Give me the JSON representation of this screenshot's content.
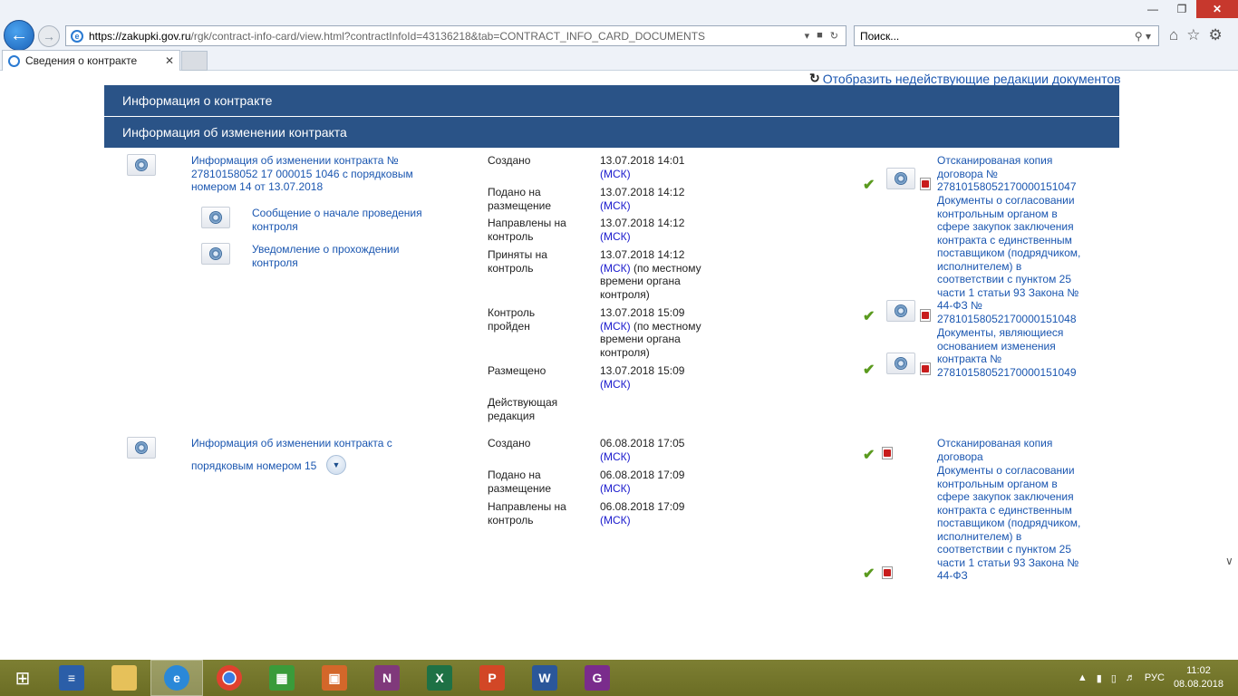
{
  "browser": {
    "url_host": "https://zakupki.gov.ru",
    "url_rest": "/rgk/contract-info-card/view.html?contractInfoId=43136218&tab=CONTRACT_INFO_CARD_DOCUMENTS",
    "search_placeholder": "Поиск...",
    "tab_title": "Сведения о контракте"
  },
  "page": {
    "show_inactive_link": "Отобразить недействующие редакции документов",
    "section_contract_info": "Информация о контракте",
    "section_change_info": "Информация об изменении контракта"
  },
  "entry1": {
    "title": "Информация об изменении контракта № 27810158052 17 000015 1046 с порядковым номером 14 от 13.07.2018",
    "sub1": "Сообщение о начале проведения контроля",
    "sub2": "Уведомление о прохождении контроля",
    "statuses": [
      {
        "label": "Создано",
        "value": "13.07.2018 14:01",
        "tz": "(МСК)",
        "note": ""
      },
      {
        "label": "Подано на размещение",
        "value": "13.07.2018 14:12",
        "tz": "(МСК)",
        "note": ""
      },
      {
        "label": "Направлены на контроль",
        "value": "13.07.2018 14:12",
        "tz": "(МСК)",
        "note": ""
      },
      {
        "label": "Приняты на контроль",
        "value": "13.07.2018 14:12",
        "tz": "(МСК)",
        "note": " (по местному времени органа контроля)"
      },
      {
        "label": "Контроль пройден",
        "value": "13.07.2018 15:09",
        "tz": "(МСК)",
        "note": " (по местному времени органа контроля)"
      },
      {
        "label": "Размещено",
        "value": "13.07.2018 15:09",
        "tz": "(МСК)",
        "note": ""
      },
      {
        "label": "Действующая редакция",
        "value": "",
        "tz": "",
        "note": ""
      }
    ],
    "docs": [
      "Отсканированая копия договора № 27810158052170000151047",
      "Документы о согласовании контрольным органом в сфере закупок заключения контракта с единственным поставщиком (подрядчиком, исполнителем) в соответствии с пунктом 25 части 1 статьи 93 Закона № 44-ФЗ № 27810158052170000151048",
      "Документы, являющиеся основанием изменения контракта № 27810158052170000151049"
    ]
  },
  "entry2": {
    "title_line1": "Информация об изменении контракта с",
    "title_line2": "порядковым номером 15",
    "statuses": [
      {
        "label": "Создано",
        "value": "06.08.2018 17:05",
        "tz": "(МСК)"
      },
      {
        "label": "Подано на размещение",
        "value": "06.08.2018 17:09",
        "tz": "(МСК)"
      },
      {
        "label": "Направлены на контроль",
        "value": "06.08.2018 17:09",
        "tz": "(МСК)"
      }
    ],
    "docs": [
      "Отсканированая копия договора",
      "Документы о согласовании контрольным органом в сфере закупок заключения контракта с единственным поставщиком (подрядчиком, исполнителем) в соответствии с пунктом 25 части 1 статьи 93 Закона № 44-ФЗ"
    ]
  },
  "taskbar": {
    "lang": "РУС",
    "time": "11:02",
    "date": "08.08.2018"
  }
}
